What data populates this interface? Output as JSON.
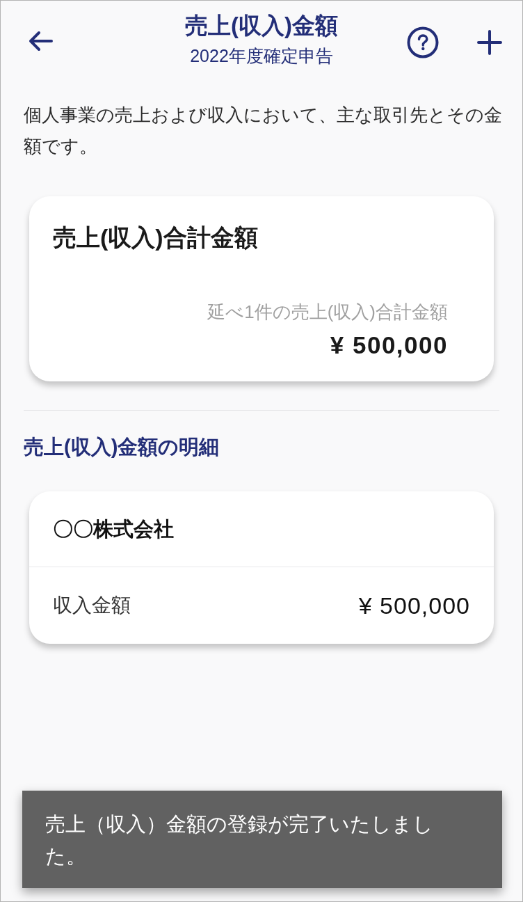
{
  "header": {
    "title": "売上(収入)金額",
    "subtitle": "2022年度確定申告"
  },
  "description": "個人事業の売上および収入において、主な取引先とその金額です。",
  "summary_card": {
    "title": "売上(収入)合計金額",
    "caption": "延べ1件の売上(収入)合計金額",
    "total": "¥ 500,000"
  },
  "details": {
    "heading": "売上(収入)金額の明細",
    "entries": [
      {
        "client": "〇〇株式会社",
        "label": "収入金額",
        "amount": "¥ 500,000"
      }
    ]
  },
  "toast": {
    "message": "売上（収入）金額の登録が完了いたしました。"
  }
}
